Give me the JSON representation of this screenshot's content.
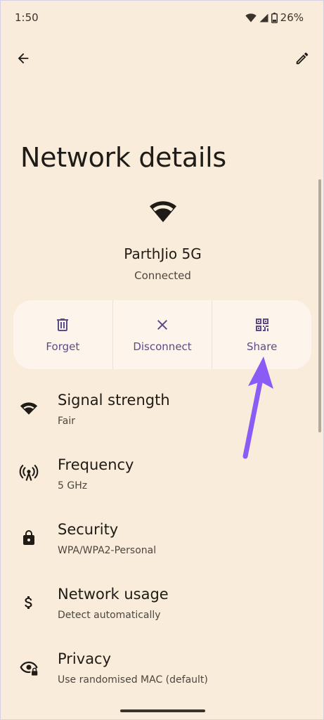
{
  "status_bar": {
    "time": "1:50",
    "battery": "26%"
  },
  "top_bar": {
    "back_icon": "arrow-back-icon",
    "edit_icon": "pencil-icon"
  },
  "page": {
    "title": "Network details"
  },
  "network": {
    "icon": "wifi-icon",
    "name": "ParthJio 5G",
    "status": "Connected"
  },
  "actions": [
    {
      "label": "Forget",
      "icon": "trash-icon"
    },
    {
      "label": "Disconnect",
      "icon": "close-icon"
    },
    {
      "label": "Share",
      "icon": "qr-code-icon"
    }
  ],
  "details": [
    {
      "title": "Signal strength",
      "subtitle": "Fair",
      "icon": "wifi-signal-icon"
    },
    {
      "title": "Frequency",
      "subtitle": "5 GHz",
      "icon": "antenna-icon"
    },
    {
      "title": "Security",
      "subtitle": "WPA/WPA2-Personal",
      "icon": "lock-icon"
    },
    {
      "title": "Network usage",
      "subtitle": "Detect automatically",
      "icon": "dollar-icon"
    },
    {
      "title": "Privacy",
      "subtitle": "Use randomised MAC (default)",
      "icon": "privacy-eye-icon"
    }
  ],
  "colors": {
    "background": "#f9ecda",
    "accent": "#5a4c86",
    "annotation_arrow": "#8a5cf5"
  }
}
